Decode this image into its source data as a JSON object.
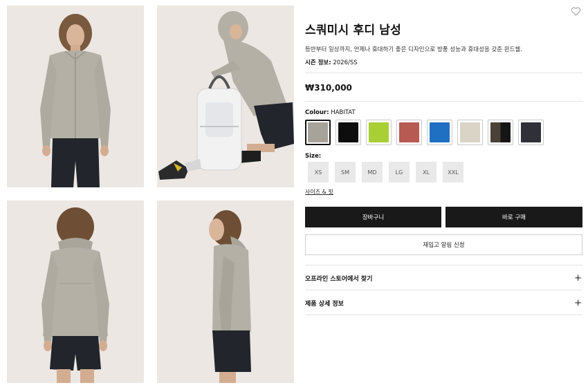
{
  "product": {
    "title": "스쿼미시 후디 남성",
    "description": "등반부터 일상까지, 언제나 휴대하기 좋은 디자인으로 방풍 성능과 휴대성을 갖춘 윈드쉘.",
    "season_label": "시즌 정보:",
    "season_value": "2026/SS",
    "price": "₩310,000",
    "wishlist_icon": "heart-outline-icon"
  },
  "colour": {
    "label": "Colour:",
    "selected": "HABITAT",
    "swatches": [
      {
        "color": "#a8a39a",
        "color2": "#a8a39a",
        "selected": true
      },
      {
        "color": "#0d0d0d",
        "color2": "#0d0d0d",
        "selected": false
      },
      {
        "color": "#a8cf34",
        "color2": "#a8cf34",
        "selected": false
      },
      {
        "color": "#b75a52",
        "color2": "#b75a52",
        "selected": false
      },
      {
        "color": "#1f6fc3",
        "color2": "#1f6fc3",
        "selected": false
      },
      {
        "color": "#d9d4c6",
        "color2": "#d9d4c6",
        "selected": false
      },
      {
        "color": "#4a4238",
        "color2": "#151515",
        "selected": false
      },
      {
        "color": "#2f3038",
        "color2": "#2f3038",
        "selected": false
      }
    ]
  },
  "size": {
    "label": "Size:",
    "options": [
      "XS",
      "SM",
      "MD",
      "LG",
      "XL",
      "XXL"
    ],
    "fit_link": "사이즈 & 핏"
  },
  "actions": {
    "cart": "장바구니",
    "buy_now": "바로 구매",
    "restock": "재입고 알림 신청"
  },
  "accordion": [
    {
      "label": "오프라인 스토어에서 찾기",
      "icon": "plus-icon"
    },
    {
      "label": "제품 상세 정보",
      "icon": "plus-icon"
    }
  ],
  "gallery": {
    "background": "#ece7e2",
    "jacket_color": "#b4b0a6",
    "shorts_color": "#22252b"
  }
}
